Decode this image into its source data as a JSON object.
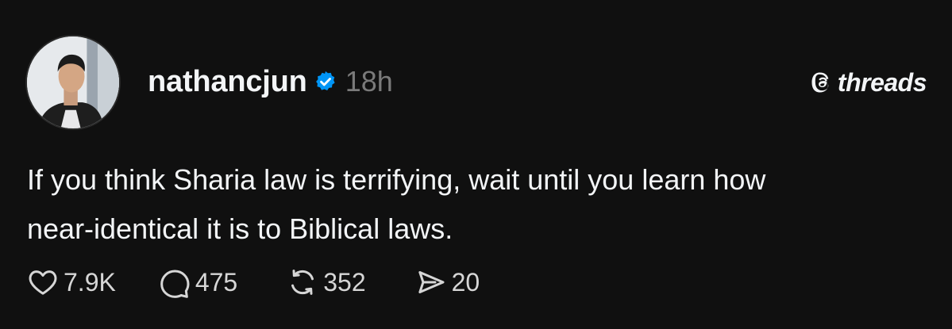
{
  "post": {
    "author": {
      "username": "nathancjun",
      "verified": true,
      "avatar_icon": "profile-photo"
    },
    "time": "18h",
    "brand": {
      "icon": "threads-logo-icon",
      "name": "threads"
    },
    "text_lines": [
      "If you think Sharia law is terrifying, wait until you learn how",
      "near-identical it is to Biblical laws."
    ],
    "actions": {
      "likes": {
        "icon": "heart-icon",
        "count": "7.9K"
      },
      "replies": {
        "icon": "comment-icon",
        "count": "475"
      },
      "reposts": {
        "icon": "repost-icon",
        "count": "352"
      },
      "shares": {
        "icon": "send-icon",
        "count": "20"
      }
    }
  },
  "colors": {
    "background": "#101010",
    "text": "#f3f5f7",
    "muted": "#7a7a7a",
    "verified": "#0095f6"
  }
}
